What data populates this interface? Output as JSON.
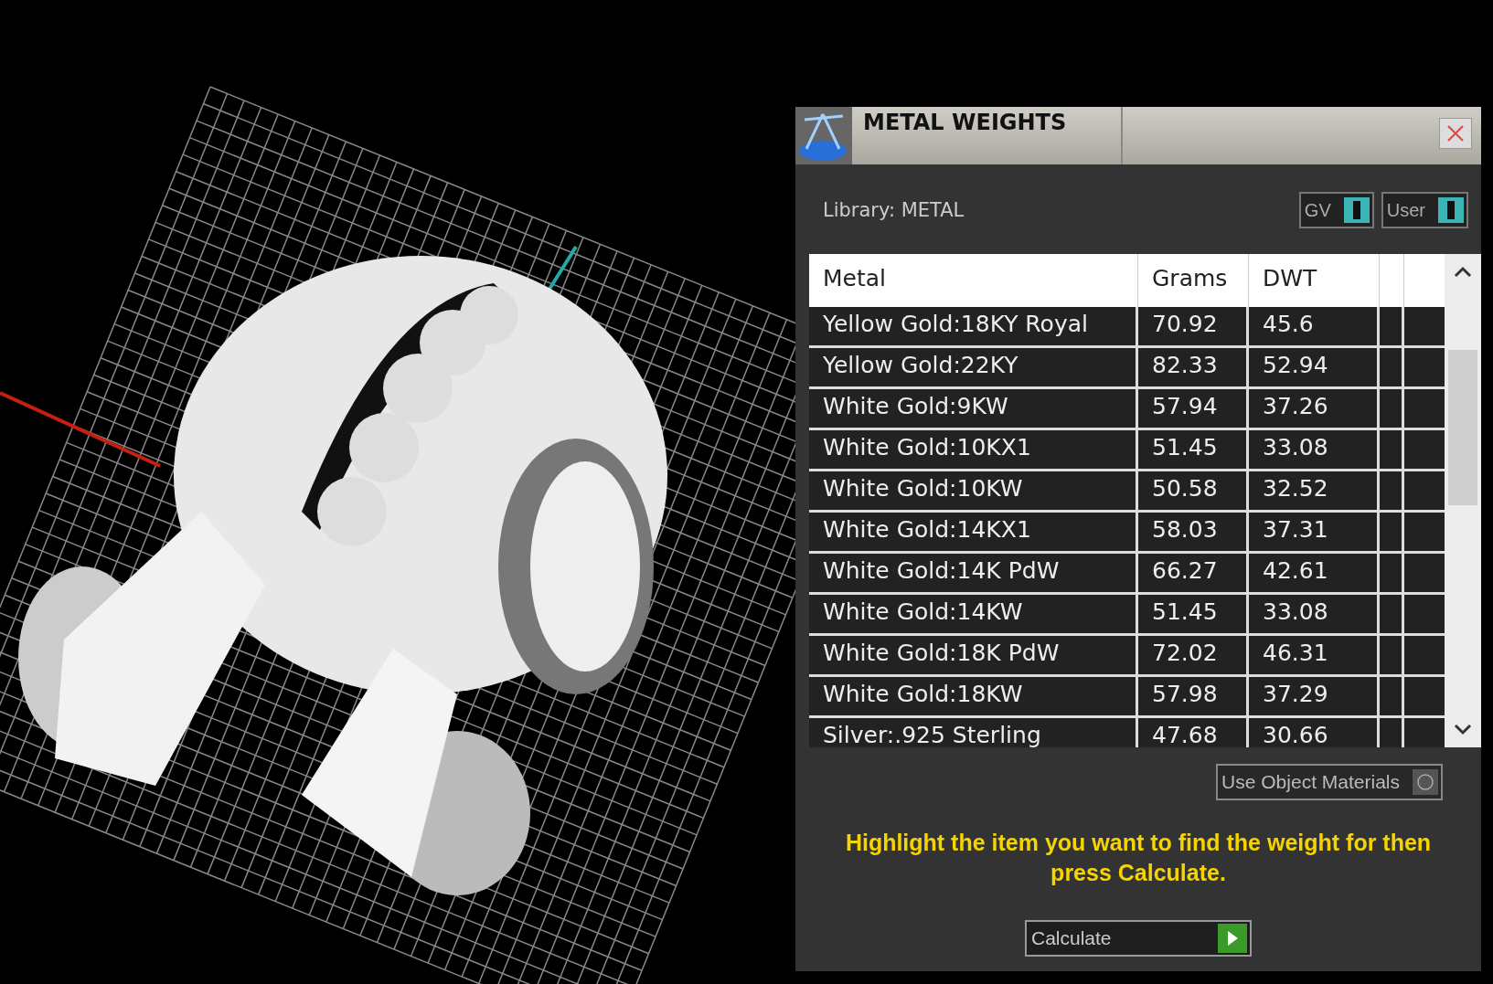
{
  "panel": {
    "title": "METAL WEIGHTS",
    "library_label": "Library: METAL",
    "toggles": [
      {
        "label": "GV",
        "on": true
      },
      {
        "label": "User",
        "on": true
      }
    ],
    "table": {
      "columns": [
        "Metal",
        "Grams",
        "DWT"
      ],
      "rows": [
        {
          "metal": "Yellow Gold:18KY Royal",
          "grams": "70.92",
          "dwt": "45.6"
        },
        {
          "metal": "Yellow Gold:22KY",
          "grams": "82.33",
          "dwt": "52.94"
        },
        {
          "metal": "White Gold:9KW",
          "grams": "57.94",
          "dwt": "37.26"
        },
        {
          "metal": "White Gold:10KX1",
          "grams": "51.45",
          "dwt": "33.08"
        },
        {
          "metal": "White Gold:10KW",
          "grams": "50.58",
          "dwt": "32.52"
        },
        {
          "metal": "White Gold:14KX1",
          "grams": "58.03",
          "dwt": "37.31"
        },
        {
          "metal": "White Gold:14K PdW",
          "grams": "66.27",
          "dwt": "42.61"
        },
        {
          "metal": "White Gold:14KW",
          "grams": "51.45",
          "dwt": "33.08"
        },
        {
          "metal": "White Gold:18K PdW",
          "grams": "72.02",
          "dwt": "46.31"
        },
        {
          "metal": "White Gold:18KW",
          "grams": "57.98",
          "dwt": "37.29"
        },
        {
          "metal": "Silver:.925 Sterling",
          "grams": "47.68",
          "dwt": "30.66"
        }
      ]
    },
    "use_object_materials": {
      "label": "Use Object Materials",
      "on": false
    },
    "hint": "Highlight the item you want to find the weight for then press Calculate.",
    "calculate_button": "Calculate"
  }
}
